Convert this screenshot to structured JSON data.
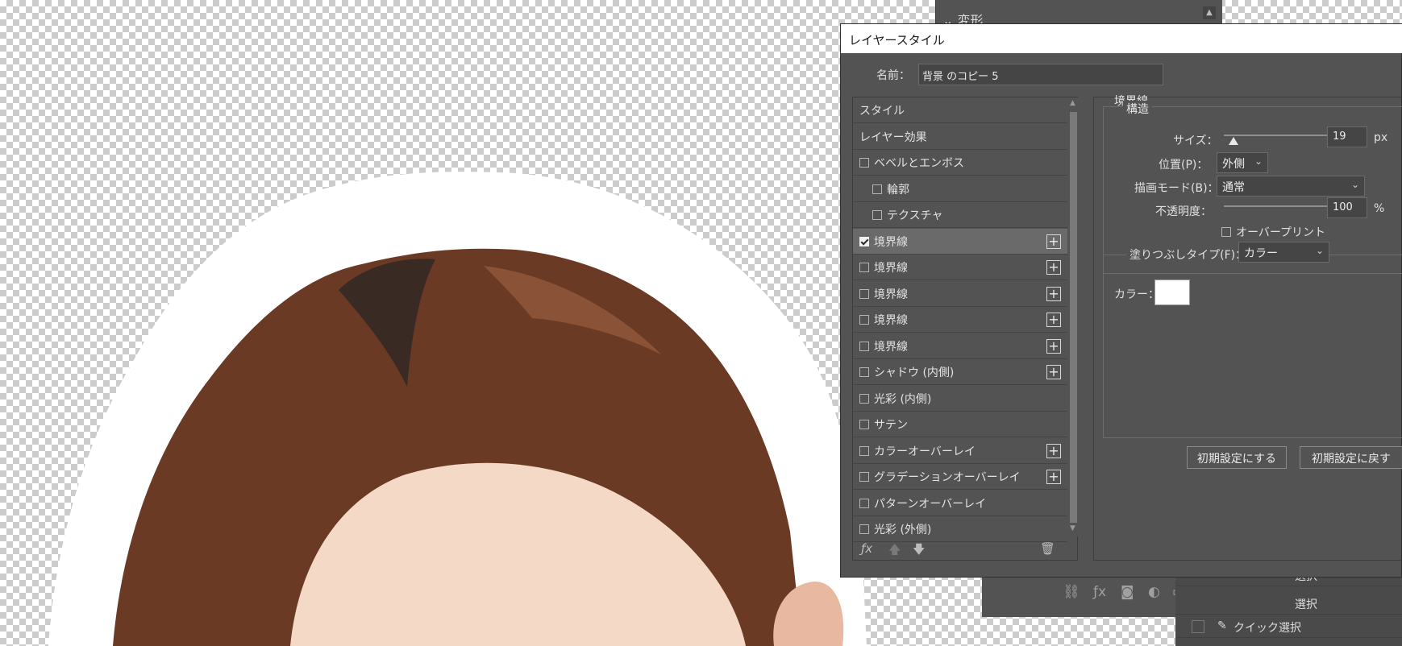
{
  "background_panel": {
    "header_label": "変形",
    "history_items": [
      "選択",
      "選択",
      "クイック選択"
    ]
  },
  "dialog": {
    "title": "レイヤースタイル",
    "name_label": "名前：",
    "name_value": "背景 のコピー 5"
  },
  "style_list": [
    {
      "label": "スタイル",
      "checkbox": false,
      "checked": false,
      "plus": false,
      "indent": false,
      "selected": false
    },
    {
      "label": "レイヤー効果",
      "checkbox": false,
      "checked": false,
      "plus": false,
      "indent": false,
      "selected": false
    },
    {
      "label": "ベベルとエンボス",
      "checkbox": true,
      "checked": false,
      "plus": false,
      "indent": false,
      "selected": false
    },
    {
      "label": "輪郭",
      "checkbox": true,
      "checked": false,
      "plus": false,
      "indent": true,
      "selected": false
    },
    {
      "label": "テクスチャ",
      "checkbox": true,
      "checked": false,
      "plus": false,
      "indent": true,
      "selected": false
    },
    {
      "label": "境界線",
      "checkbox": true,
      "checked": true,
      "plus": true,
      "indent": false,
      "selected": true
    },
    {
      "label": "境界線",
      "checkbox": true,
      "checked": false,
      "plus": true,
      "indent": false,
      "selected": false
    },
    {
      "label": "境界線",
      "checkbox": true,
      "checked": false,
      "plus": true,
      "indent": false,
      "selected": false
    },
    {
      "label": "境界線",
      "checkbox": true,
      "checked": false,
      "plus": true,
      "indent": false,
      "selected": false
    },
    {
      "label": "境界線",
      "checkbox": true,
      "checked": false,
      "plus": true,
      "indent": false,
      "selected": false
    },
    {
      "label": "シャドウ (内側)",
      "checkbox": true,
      "checked": false,
      "plus": true,
      "indent": false,
      "selected": false
    },
    {
      "label": "光彩 (内側)",
      "checkbox": true,
      "checked": false,
      "plus": false,
      "indent": false,
      "selected": false
    },
    {
      "label": "サテン",
      "checkbox": true,
      "checked": false,
      "plus": false,
      "indent": false,
      "selected": false
    },
    {
      "label": "カラーオーバーレイ",
      "checkbox": true,
      "checked": false,
      "plus": true,
      "indent": false,
      "selected": false
    },
    {
      "label": "グラデーションオーバーレイ",
      "checkbox": true,
      "checked": false,
      "plus": true,
      "indent": false,
      "selected": false
    },
    {
      "label": "パターンオーバーレイ",
      "checkbox": true,
      "checked": false,
      "plus": false,
      "indent": false,
      "selected": false
    },
    {
      "label": "光彩 (外側)",
      "checkbox": true,
      "checked": false,
      "plus": false,
      "indent": false,
      "selected": false
    }
  ],
  "stroke_settings": {
    "section_title": "境界線",
    "structure_title": "構造",
    "size_label": "サイズ：",
    "size_value": "19",
    "size_unit": "px",
    "size_slider_fraction": 0.076,
    "position_label": "位置(P)：",
    "position_value": "外側",
    "blend_label": "描画モード(B)：",
    "blend_value": "通常",
    "opacity_label": "不透明度：",
    "opacity_value": "100",
    "opacity_unit": "%",
    "opacity_slider_fraction": 1.0,
    "overprint_label": "オーバープリント",
    "fill_type_label": "塗りつぶしタイプ(F)：",
    "fill_type_value": "カラー",
    "color_label": "カラー：",
    "color_value": "#ffffff",
    "make_default_button": "初期設定にする",
    "reset_default_button": "初期設定に戻す"
  },
  "colors": {
    "panel_bg": "#535353",
    "selected_row": "#6a6a6a",
    "hair": "#6b3a24",
    "skin": "#f3d9c6"
  }
}
